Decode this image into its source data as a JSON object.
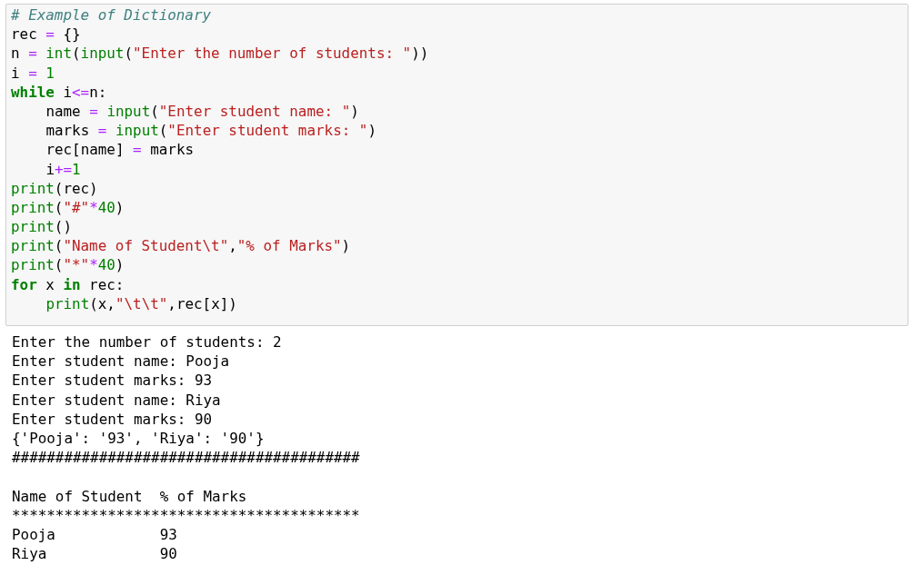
{
  "code_cell": {
    "lines": [
      {
        "indented": false,
        "tokens": [
          {
            "kind": "comment",
            "text": "# Example of Dictionary"
          }
        ]
      },
      {
        "indented": false,
        "tokens": [
          {
            "kind": "plain",
            "text": "rec "
          },
          {
            "kind": "operator",
            "text": "="
          },
          {
            "kind": "plain",
            "text": " {}"
          }
        ]
      },
      {
        "indented": false,
        "tokens": [
          {
            "kind": "plain",
            "text": "n "
          },
          {
            "kind": "operator",
            "text": "="
          },
          {
            "kind": "builtin",
            "text": " int"
          },
          {
            "kind": "plain",
            "text": "("
          },
          {
            "kind": "builtin",
            "text": "input"
          },
          {
            "kind": "plain",
            "text": "("
          },
          {
            "kind": "string",
            "text": "\"Enter the number of students: \""
          },
          {
            "kind": "plain",
            "text": "))"
          }
        ]
      },
      {
        "indented": false,
        "tokens": [
          {
            "kind": "plain",
            "text": "i "
          },
          {
            "kind": "operator",
            "text": "="
          },
          {
            "kind": "number",
            "text": " 1"
          }
        ]
      },
      {
        "indented": false,
        "tokens": [
          {
            "kind": "keyword",
            "text": "while"
          },
          {
            "kind": "plain",
            "text": " i"
          },
          {
            "kind": "operator",
            "text": "<="
          },
          {
            "kind": "plain",
            "text": "n:"
          }
        ]
      },
      {
        "indented": true,
        "tokens": [
          {
            "kind": "plain",
            "text": "name "
          },
          {
            "kind": "operator",
            "text": "="
          },
          {
            "kind": "builtin",
            "text": " input"
          },
          {
            "kind": "plain",
            "text": "("
          },
          {
            "kind": "string",
            "text": "\"Enter student name: \""
          },
          {
            "kind": "plain",
            "text": ")"
          }
        ]
      },
      {
        "indented": true,
        "tokens": [
          {
            "kind": "plain",
            "text": "marks "
          },
          {
            "kind": "operator",
            "text": "="
          },
          {
            "kind": "builtin",
            "text": " input"
          },
          {
            "kind": "plain",
            "text": "("
          },
          {
            "kind": "string",
            "text": "\"Enter student marks: \""
          },
          {
            "kind": "plain",
            "text": ")"
          }
        ]
      },
      {
        "indented": true,
        "tokens": [
          {
            "kind": "plain",
            "text": "rec[name] "
          },
          {
            "kind": "operator",
            "text": "="
          },
          {
            "kind": "plain",
            "text": " marks"
          }
        ]
      },
      {
        "indented": true,
        "tokens": [
          {
            "kind": "plain",
            "text": "i"
          },
          {
            "kind": "operator",
            "text": "+="
          },
          {
            "kind": "number",
            "text": "1"
          }
        ]
      },
      {
        "indented": false,
        "tokens": [
          {
            "kind": "builtin",
            "text": "print"
          },
          {
            "kind": "plain",
            "text": "(rec)"
          }
        ]
      },
      {
        "indented": false,
        "tokens": [
          {
            "kind": "builtin",
            "text": "print"
          },
          {
            "kind": "plain",
            "text": "("
          },
          {
            "kind": "string",
            "text": "\"#\""
          },
          {
            "kind": "operator",
            "text": "*"
          },
          {
            "kind": "number",
            "text": "40"
          },
          {
            "kind": "plain",
            "text": ")"
          }
        ]
      },
      {
        "indented": false,
        "tokens": [
          {
            "kind": "builtin",
            "text": "print"
          },
          {
            "kind": "plain",
            "text": "()"
          }
        ]
      },
      {
        "indented": false,
        "tokens": [
          {
            "kind": "builtin",
            "text": "print"
          },
          {
            "kind": "plain",
            "text": "("
          },
          {
            "kind": "string",
            "text": "\"Name of Student\\t\""
          },
          {
            "kind": "plain",
            "text": ","
          },
          {
            "kind": "string",
            "text": "\"% of Marks\""
          },
          {
            "kind": "plain",
            "text": ")"
          }
        ]
      },
      {
        "indented": false,
        "tokens": [
          {
            "kind": "builtin",
            "text": "print"
          },
          {
            "kind": "plain",
            "text": "("
          },
          {
            "kind": "string",
            "text": "\"*\""
          },
          {
            "kind": "operator",
            "text": "*"
          },
          {
            "kind": "number",
            "text": "40"
          },
          {
            "kind": "plain",
            "text": ")"
          }
        ]
      },
      {
        "indented": false,
        "tokens": [
          {
            "kind": "keyword",
            "text": "for"
          },
          {
            "kind": "plain",
            "text": " x "
          },
          {
            "kind": "keyword",
            "text": "in"
          },
          {
            "kind": "plain",
            "text": " rec:"
          }
        ]
      },
      {
        "indented": true,
        "tokens": [
          {
            "kind": "builtin",
            "text": "print"
          },
          {
            "kind": "plain",
            "text": "(x,"
          },
          {
            "kind": "string",
            "text": "\"\\t\\t\""
          },
          {
            "kind": "plain",
            "text": ",rec[x])"
          }
        ]
      }
    ]
  },
  "output": {
    "lines": [
      {
        "kind": "text",
        "text": "Enter the number of students: 2"
      },
      {
        "kind": "text",
        "text": "Enter student name: Pooja"
      },
      {
        "kind": "text",
        "text": "Enter student marks: 93"
      },
      {
        "kind": "text",
        "text": "Enter student name: Riya"
      },
      {
        "kind": "text",
        "text": "Enter student marks: 90"
      },
      {
        "kind": "text",
        "text": "{'Pooja': '93', 'Riya': '90'}"
      },
      {
        "kind": "text",
        "text": "########################################"
      },
      {
        "kind": "blank"
      },
      {
        "kind": "text",
        "text": "Name of Student  % of Marks"
      },
      {
        "kind": "text",
        "text": "****************************************"
      },
      {
        "kind": "text",
        "text": "Pooja            93"
      },
      {
        "kind": "text",
        "text": "Riya             90"
      }
    ]
  }
}
